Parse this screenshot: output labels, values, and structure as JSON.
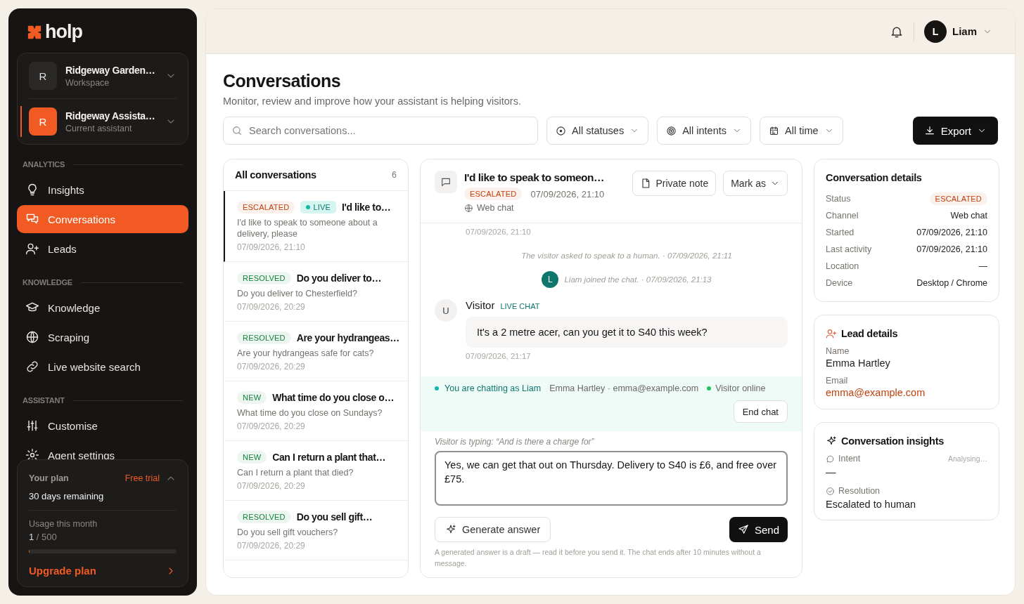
{
  "sidebar": {
    "logo": "holp",
    "switchers": [
      {
        "avatar": "R",
        "name": "Ridgeway Garden…",
        "caption": "Workspace",
        "selected": false
      },
      {
        "avatar": "R",
        "name": "Ridgeway Assista…",
        "caption": "Current assistant",
        "selected": true
      }
    ],
    "sections": [
      {
        "heading": "ANALYTICS",
        "items": [
          {
            "label": "Insights",
            "selected": false
          },
          {
            "label": "Conversations",
            "selected": true
          },
          {
            "label": "Leads",
            "selected": false
          }
        ]
      },
      {
        "heading": "KNOWLEDGE",
        "items": [
          {
            "label": "Knowledge",
            "selected": false
          },
          {
            "label": "Scraping",
            "selected": false
          },
          {
            "label": "Live website search",
            "selected": false
          }
        ]
      },
      {
        "heading": "ASSISTANT",
        "items": [
          {
            "label": "Customise",
            "selected": false
          },
          {
            "label": "Agent settings",
            "selected": false
          }
        ]
      }
    ],
    "plan": {
      "label": "Your plan",
      "badge": "Free trial",
      "expanded": true,
      "remaining": "30 days remaining",
      "usage_label": "Usage this month",
      "usage_count": "1",
      "usage_limit": "/ 500",
      "level": 0.002,
      "upgrade": "Upgrade plan"
    }
  },
  "header": {
    "user_avatar": "L",
    "user_name": "Liam"
  },
  "page": {
    "title": "Conversations",
    "subtitle": "Monitor, review and improve how your assistant is helping visitors.",
    "search": {
      "placeholder": "Search conversations..."
    },
    "filters": [
      {
        "label": "All statuses"
      },
      {
        "label": "All intents"
      },
      {
        "label": "All time"
      }
    ],
    "export": "Export"
  },
  "conversation_list": {
    "title": "All conversations",
    "count": "6",
    "items": [
      {
        "status": "ESCALATED",
        "color": "#c2410c",
        "live": true,
        "live_label": "LIVE",
        "title": "I'd like to…",
        "preview": "I'd like to speak to someone about a delivery, please",
        "time": "07/09/2026, 21:10",
        "selected": true
      },
      {
        "status": "RESOLVED",
        "color": "#15803d",
        "live": false,
        "title": "Do you deliver to…",
        "preview": "Do you deliver to Chesterfield?",
        "time": "07/09/2026, 20:29",
        "selected": false
      },
      {
        "status": "RESOLVED",
        "color": "#15803d",
        "live": false,
        "title": "Are your hydrangeas…",
        "preview": "Are your hydrangeas safe for cats?",
        "time": "07/09/2026, 20:29",
        "selected": false
      },
      {
        "status": "NEW",
        "color": "#15803d",
        "live": false,
        "title": "What time do you close o…",
        "preview": "What time do you close on Sundays?",
        "time": "07/09/2026, 20:29",
        "selected": false
      },
      {
        "status": "NEW",
        "color": "#15803d",
        "live": false,
        "title": "Can I return a plant that…",
        "preview": "Can I return a plant that died?",
        "time": "07/09/2026, 20:29",
        "selected": false
      },
      {
        "status": "RESOLVED",
        "color": "#15803d",
        "live": false,
        "title": "Do you sell gift…",
        "preview": "Do you sell gift vouchers?",
        "time": "07/09/2026, 20:29",
        "selected": false
      }
    ]
  },
  "chat": {
    "title": "I'd like to speak to someon…",
    "status": "ESCALATED",
    "color": "#c2410c",
    "time": "07/09/2026, 21:10",
    "channel": "Web chat",
    "actions": [
      {
        "label": "Private note",
        "kind": "note"
      },
      {
        "label": "Mark as",
        "kind": "menu"
      }
    ],
    "messages": [
      {
        "kind": "timestamp",
        "text": "07/09/2026, 21:10"
      },
      {
        "kind": "event",
        "text": "The visitor asked to speak to a human. · 07/09/2026, 21:11"
      },
      {
        "kind": "join",
        "avatar": "L",
        "text": "Liam joined the chat. · 07/09/2026, 21:13"
      },
      {
        "kind": "visitor",
        "avatar": "U",
        "sender": "Visitor",
        "tag": "LIVE CHAT",
        "text": "It's a 2 metre acer, can you get it to S40 this week?",
        "time": "07/09/2026, 21:17"
      }
    ],
    "live_banner": {
      "status": "You are chatting as Liam",
      "visitor": "Emma Hartley · emma@example.com",
      "presence": "Visitor online",
      "end": "End chat"
    },
    "typing": "Visitor is typing: “And is there a charge for”",
    "draft": "Yes, we can get that out on Thursday. Delivery to S40 is £6, and free over £75.",
    "generate": "Generate answer",
    "send": "Send",
    "note": "A generated answer is a draft — read it before you send it. The chat ends after 10 minutes without a message."
  },
  "details": {
    "title": "Conversation details",
    "rows": [
      {
        "label": "Status",
        "value": "ESCALATED",
        "kind": "badge",
        "color": "#c2410c"
      },
      {
        "label": "Channel",
        "value": "Web chat",
        "kind": "text"
      },
      {
        "label": "Started",
        "value": "07/09/2026, 21:10",
        "kind": "text"
      },
      {
        "label": "Last activity",
        "value": "07/09/2026, 21:10",
        "kind": "text"
      },
      {
        "label": "Location",
        "value": "—",
        "kind": "text"
      },
      {
        "label": "Device",
        "value": "Desktop / Chrome",
        "kind": "text"
      }
    ]
  },
  "lead": {
    "title": "Lead details",
    "fields": [
      {
        "label": "Name",
        "value": "Emma Hartley",
        "kind": "text"
      },
      {
        "label": "Email",
        "value": "emma@example.com",
        "kind": "link"
      }
    ]
  },
  "insights": {
    "title": "Conversation insights",
    "items": [
      {
        "label": "Intent",
        "status": "Analysing…",
        "value": "—"
      },
      {
        "label": "Resolution",
        "value": "Escalated to human"
      }
    ]
  }
}
